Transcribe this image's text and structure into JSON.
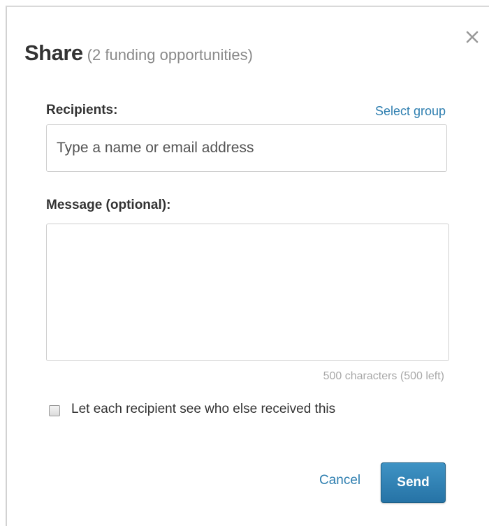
{
  "dialog": {
    "title": "Share",
    "subtitle": "(2 funding opportunities)",
    "close_icon": "close-icon"
  },
  "recipients": {
    "label": "Recipients:",
    "select_group_link": "Select group",
    "placeholder": "Type a name or email address",
    "value": ""
  },
  "message": {
    "label": "Message (optional):",
    "value": "",
    "char_count": "500 characters (500 left)"
  },
  "options": {
    "show_recipients_label": "Let each recipient see who else received this",
    "show_recipients_checked": false
  },
  "actions": {
    "cancel_label": "Cancel",
    "send_label": "Send"
  },
  "colors": {
    "accent": "#2f7fb0",
    "send_button": "#2a78aa",
    "title": "#333333",
    "muted": "#8a8a8a"
  }
}
